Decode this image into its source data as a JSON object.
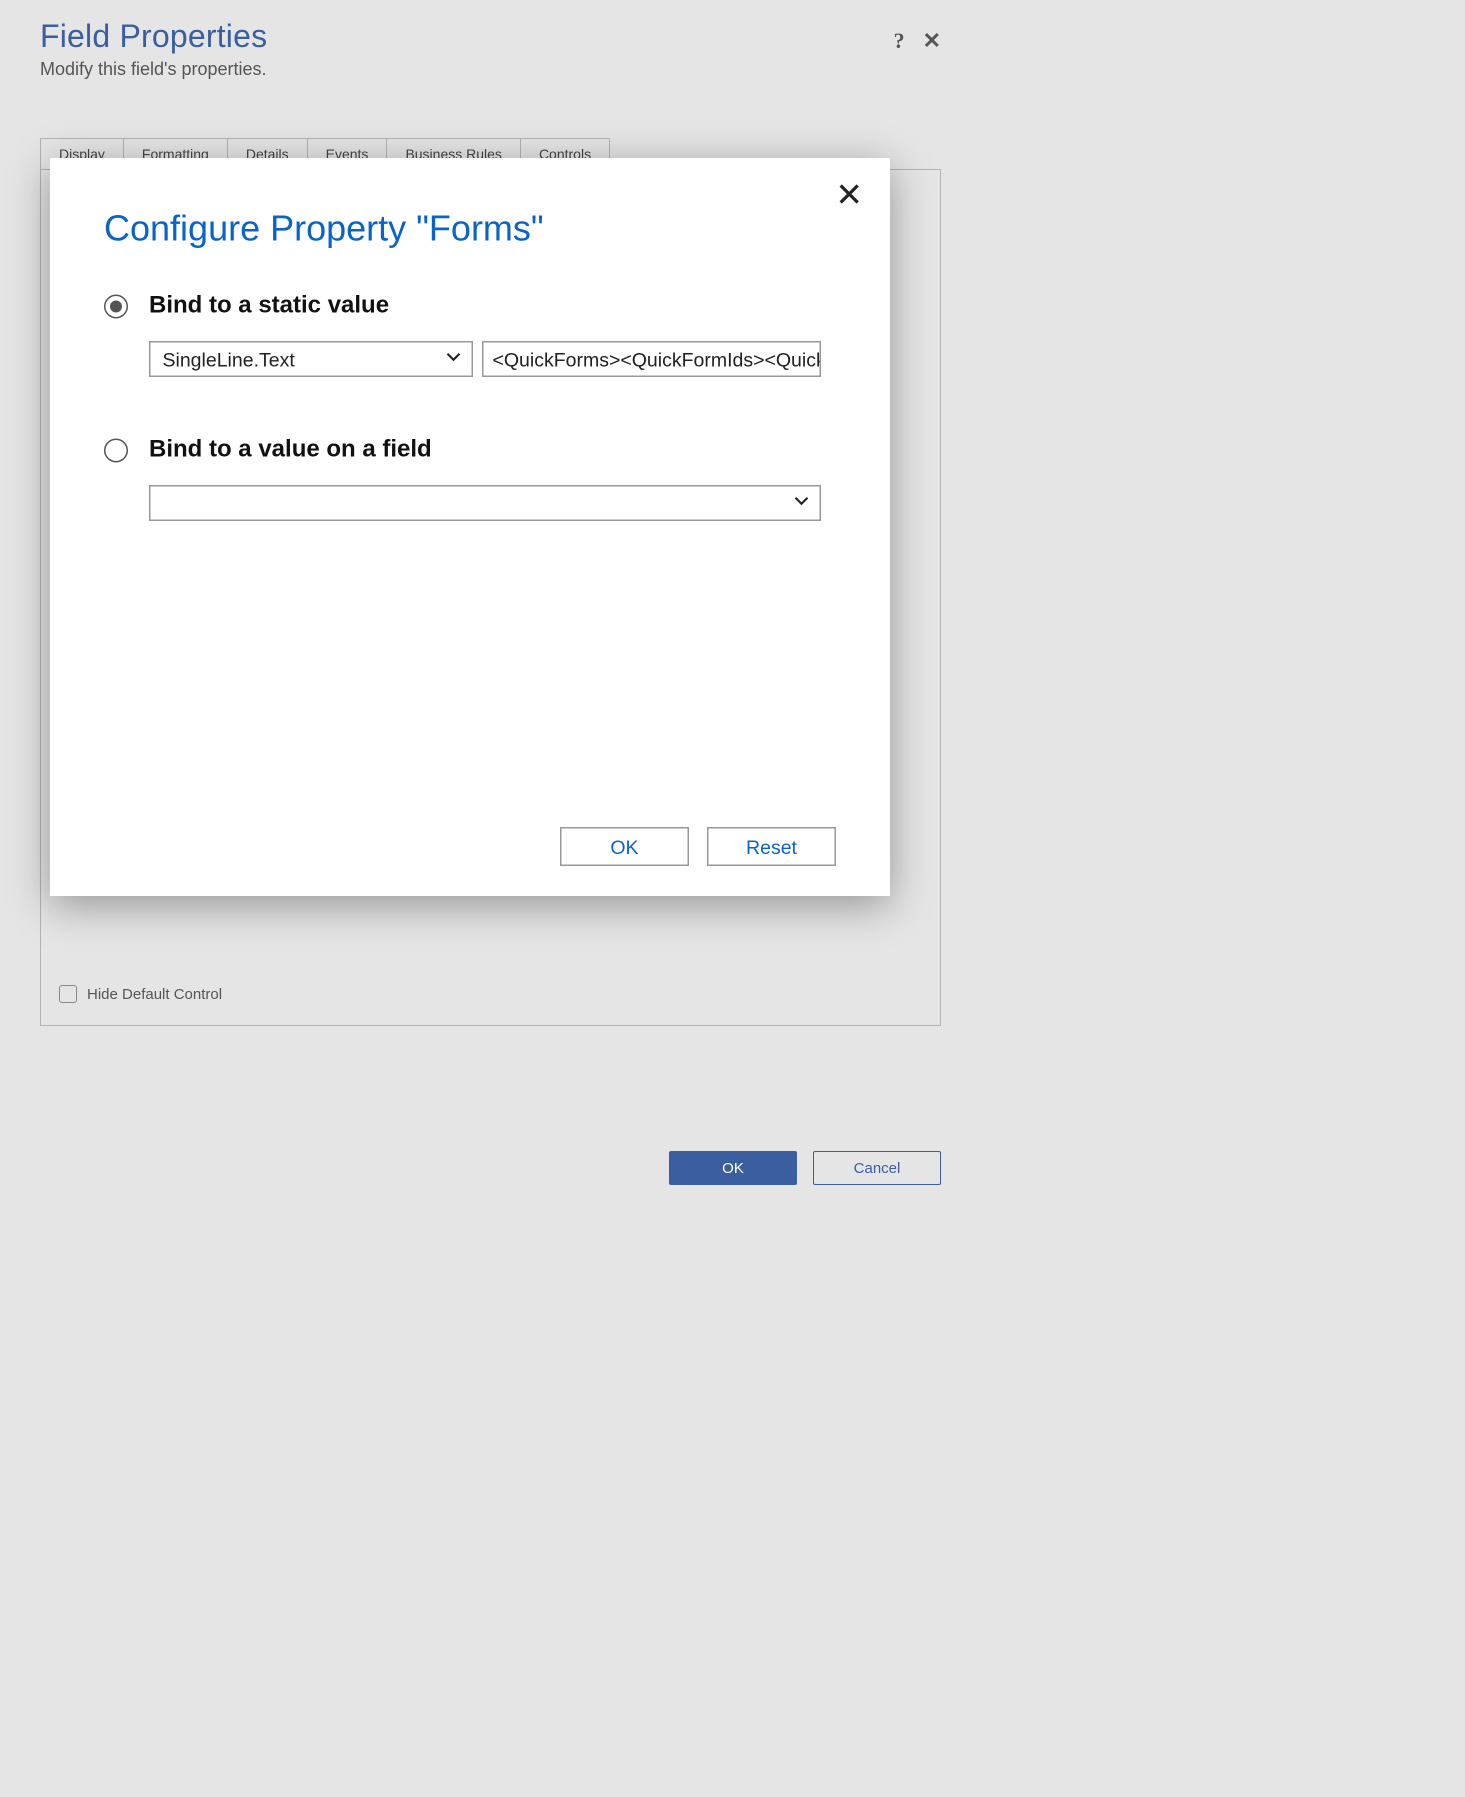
{
  "header": {
    "title": "Field Properties",
    "subtitle": "Modify this field's properties.",
    "help_icon": "?",
    "close_icon": "✕"
  },
  "tabs": [
    {
      "label": "Display"
    },
    {
      "label": "Formatting"
    },
    {
      "label": "Details"
    },
    {
      "label": "Events"
    },
    {
      "label": "Business Rules"
    },
    {
      "label": "Controls"
    }
  ],
  "active_tab_index": 5,
  "panel": {
    "hide_default_label": "Hide Default Control",
    "hide_default_checked": false
  },
  "footer": {
    "ok_label": "OK",
    "cancel_label": "Cancel"
  },
  "modal": {
    "title": "Configure Property \"Forms\"",
    "close_icon": "✕",
    "option_static": {
      "label": "Bind to a static value",
      "selected": true,
      "type_select_value": "SingleLine.Text",
      "value_text": "<QuickForms><QuickFormIds><QuickFo"
    },
    "option_field": {
      "label": "Bind to a value on a field",
      "selected": false,
      "select_value": ""
    },
    "ok_label": "OK",
    "reset_label": "Reset"
  }
}
